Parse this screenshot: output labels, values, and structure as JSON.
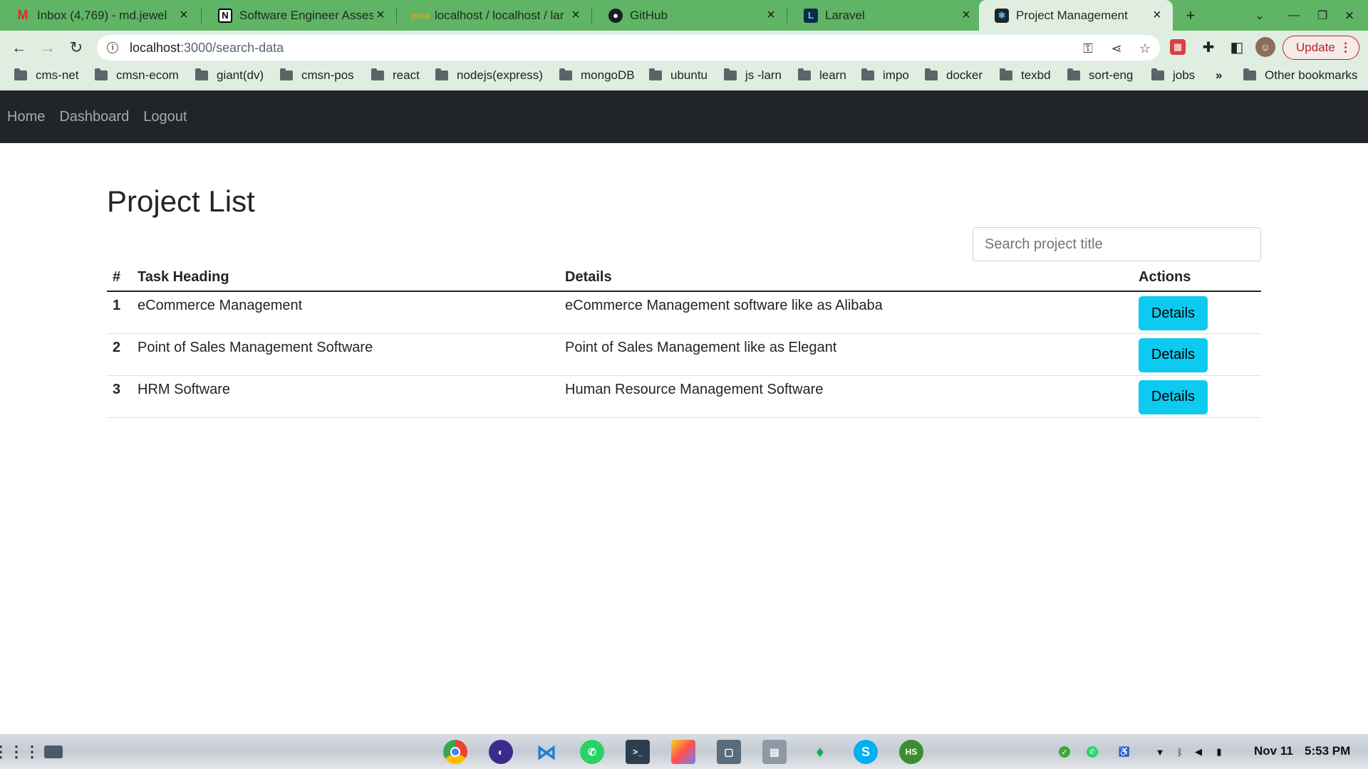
{
  "browser": {
    "tabs": [
      {
        "title": "Inbox (4,769) - md.jewel",
        "favicon": "gmail-icon",
        "active": false
      },
      {
        "title": "Software Engineer Asses",
        "favicon": "notion-icon",
        "active": false
      },
      {
        "title": "localhost / localhost / lar",
        "favicon": "phpmyadmin-icon",
        "active": false
      },
      {
        "title": "GitHub",
        "favicon": "github-icon",
        "active": false
      },
      {
        "title": "Laravel",
        "favicon": "laravel-icon",
        "active": false
      },
      {
        "title": "Project Management",
        "favicon": "react-icon",
        "active": true
      }
    ],
    "url_host": "localhost",
    "url_path": ":3000/search-data",
    "update_label": "Update",
    "bookmarks": [
      "cms-net",
      "cmsn-ecom",
      "giant(dv)",
      "cmsn-pos",
      "react",
      "nodejs(express)",
      "mongoDB",
      "ubuntu",
      "js -larn",
      "learn",
      "impo",
      "docker",
      "texbd",
      "sort-eng",
      "jobs"
    ],
    "bookmarks_overflow": "»",
    "other_bookmarks": "Other bookmarks"
  },
  "app": {
    "nav": [
      "Home",
      "Dashboard",
      "Logout"
    ],
    "page_title": "Project List",
    "search_placeholder": "Search project title",
    "table": {
      "headers": [
        "#",
        "Task Heading",
        "Details",
        "Actions"
      ],
      "rows": [
        {
          "num": "1",
          "heading": "eCommerce Management",
          "details": "eCommerce Management software like as Alibaba",
          "action": "Details"
        },
        {
          "num": "2",
          "heading": "Point of Sales Management Software",
          "details": "Point of Sales Management like as Elegant",
          "action": "Details"
        },
        {
          "num": "3",
          "heading": "HRM Software",
          "details": "Human Resource Management Software",
          "action": "Details"
        }
      ]
    }
  },
  "taskbar": {
    "date": "Nov 11",
    "time": "5:53 PM",
    "apps": [
      "chrome-icon",
      "tor-icon",
      "vscode-icon",
      "whatsapp-icon",
      "terminal-icon",
      "drawing-icon",
      "screenshot-icon",
      "files-icon",
      "mongodb-compass-icon",
      "skype-icon",
      "hs-icon"
    ]
  },
  "colors": {
    "tab_strip": "#5fb466",
    "toolbar": "#dfeee0",
    "navbar": "#212529",
    "details_button": "#0dcaf0",
    "update_button": "#c5221f"
  }
}
